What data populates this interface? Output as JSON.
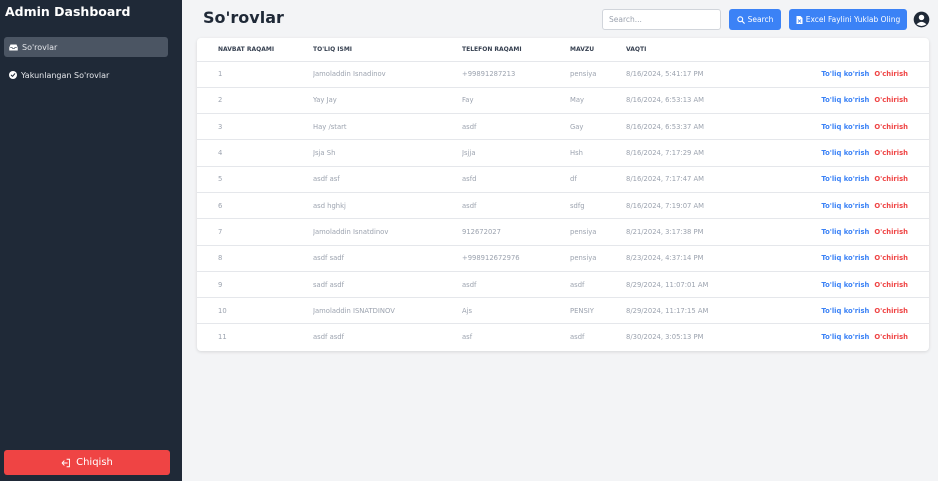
{
  "sidebar": {
    "title": "Admin Dashboard",
    "items": [
      {
        "label": "So'rovlar",
        "icon": "inbox-icon",
        "active": true
      },
      {
        "label": "Yakunlangan So'rovlar",
        "icon": "check-circle-icon",
        "active": false
      }
    ],
    "logout_label": "Chiqish",
    "logout_icon": "sign-out-icon"
  },
  "header": {
    "title": "So'rovlar",
    "search_placeholder": "Search...",
    "search_value": "",
    "search_button": "Search",
    "excel_button": "Excel Faylini Yuklab Oling",
    "user_icon": "user-circle-icon"
  },
  "table": {
    "columns": [
      "NAVBAT RAQAMI",
      "TO'LIQ ISMI",
      "TELEFON RAQAMI",
      "MAVZU",
      "VAQTI"
    ],
    "view_label": "To'liq ko'rish",
    "delete_label": "O'chirish",
    "rows": [
      {
        "id": "1",
        "name": "Jamoladdin Isnadinov",
        "phone": "+99891287213",
        "topic": "pensiya",
        "time": "8/16/2024, 5:41:17 PM"
      },
      {
        "id": "2",
        "name": "Yay Jay",
        "phone": "Fay",
        "topic": "May",
        "time": "8/16/2024, 6:53:13 AM"
      },
      {
        "id": "3",
        "name": "Hay /start",
        "phone": "asdf",
        "topic": "Gay",
        "time": "8/16/2024, 6:53:37 AM"
      },
      {
        "id": "4",
        "name": "Jsja Sh",
        "phone": "Jsjja",
        "topic": "Hsh",
        "time": "8/16/2024, 7:17:29 AM"
      },
      {
        "id": "5",
        "name": "asdf asf",
        "phone": "asfd",
        "topic": "df",
        "time": "8/16/2024, 7:17:47 AM"
      },
      {
        "id": "6",
        "name": "asd hghkj",
        "phone": "asdf",
        "topic": "sdfg",
        "time": "8/16/2024, 7:19:07 AM"
      },
      {
        "id": "7",
        "name": "Jamoladdin Isnatdinov",
        "phone": "912672027",
        "topic": "pensiya",
        "time": "8/21/2024, 3:17:38 PM"
      },
      {
        "id": "8",
        "name": "asdf sadf",
        "phone": "+998912672976",
        "topic": "pensiya",
        "time": "8/23/2024, 4:37:14 PM"
      },
      {
        "id": "9",
        "name": "sadf asdf",
        "phone": "asdf",
        "topic": "asdf",
        "time": "8/29/2024, 11:07:01 AM"
      },
      {
        "id": "10",
        "name": "Jamoladdin ISNATDINOV",
        "phone": "Ajs",
        "topic": "PENSIY",
        "time": "8/29/2024, 11:17:15 AM"
      },
      {
        "id": "11",
        "name": "asdf asdf",
        "phone": "asf",
        "topic": "asdf",
        "time": "8/30/2024, 3:05:13 PM"
      }
    ]
  },
  "colors": {
    "sidebar_bg": "#1f2937",
    "active_item_bg": "#4b5563",
    "primary": "#3b82f6",
    "danger": "#ef4444",
    "page_bg": "#f3f4f6"
  }
}
